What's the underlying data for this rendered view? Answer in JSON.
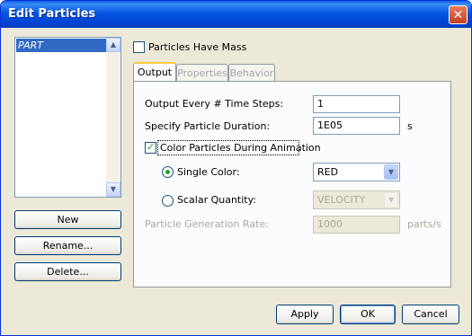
{
  "window": {
    "title": "Edit Particles"
  },
  "list": {
    "items": [
      "PART"
    ]
  },
  "left_buttons": {
    "new": "New",
    "rename": "Rename...",
    "delete": "Delete..."
  },
  "mass_checkbox": {
    "label": "Particles Have Mass",
    "checked": false
  },
  "tabs": [
    {
      "label": "Output",
      "active": true
    },
    {
      "label": "Properties",
      "active": false
    },
    {
      "label": "Behavior",
      "active": false
    }
  ],
  "output": {
    "every_label": "Output Every # Time Steps:",
    "every_value": "1",
    "duration_label": "Specify Particle Duration:",
    "duration_value": "1E05",
    "duration_unit": "s",
    "color_checkbox_label": "Color Particles During Animation",
    "color_checked": true,
    "single_color_label": "Single Color:",
    "single_color_value": "RED",
    "scalar_label": "Scalar Quantity:",
    "scalar_value": "VELOCITY",
    "selected_mode": "single",
    "rate_label": "Particle Generation Rate:",
    "rate_value": "1000",
    "rate_unit": "parts/s"
  },
  "footer_buttons": {
    "apply": "Apply",
    "ok": "OK",
    "cancel": "Cancel"
  }
}
